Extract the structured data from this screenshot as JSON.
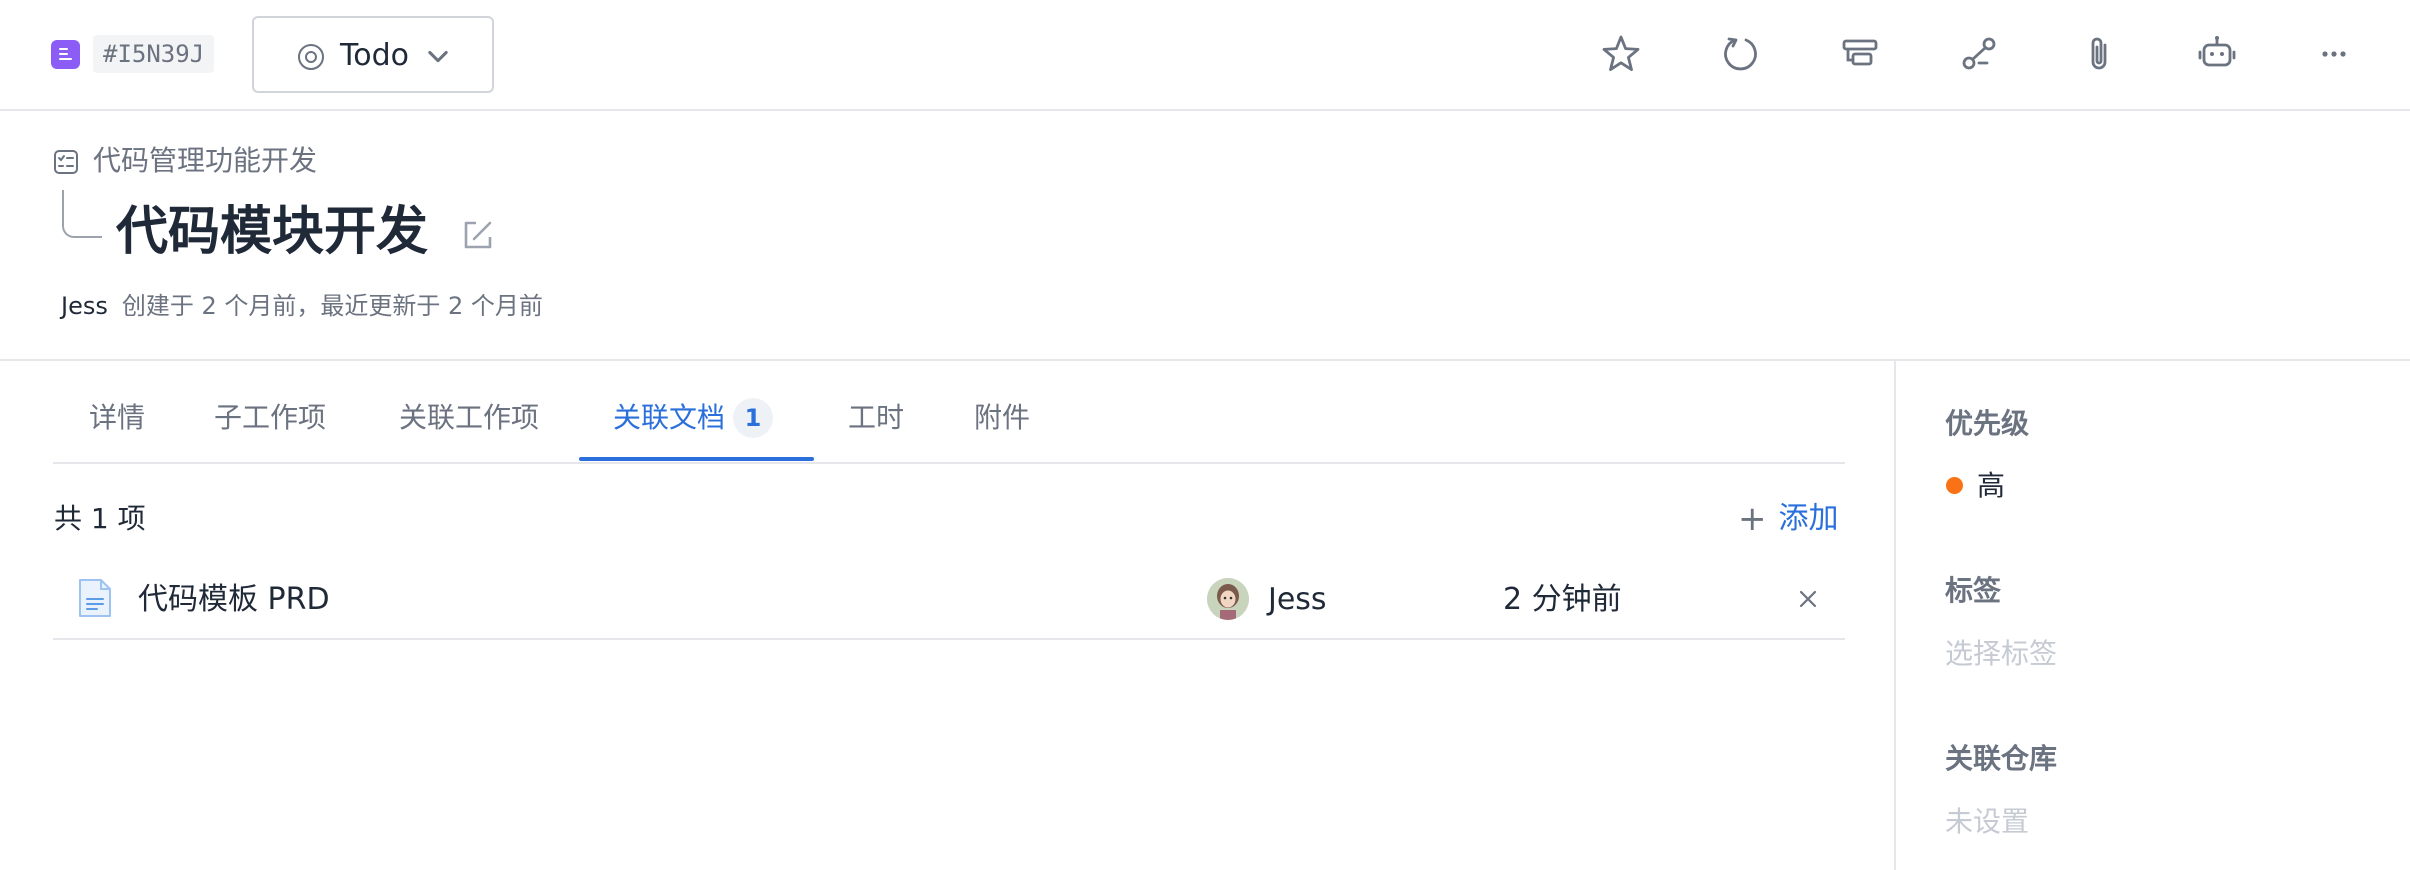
{
  "topbar": {
    "issue_id": "#I5N39J",
    "status_label": "Todo",
    "tools": [
      "star-icon",
      "refresh-icon",
      "layout-icon",
      "workflow-icon",
      "attachment-icon",
      "robot-icon",
      "more-icon"
    ]
  },
  "header": {
    "parent_title": "代码管理功能开发",
    "title": "代码模块开发",
    "author": "Jess",
    "meta_text": "创建于 2 个月前，最近更新于 2 个月前"
  },
  "tabs": [
    {
      "label": "详情"
    },
    {
      "label": "子工作项"
    },
    {
      "label": "关联工作项"
    },
    {
      "label": "关联文档",
      "count": "1",
      "active": true
    },
    {
      "label": "工时"
    },
    {
      "label": "附件"
    }
  ],
  "list": {
    "total_label": "共 1 项",
    "add_label": "添加",
    "items": [
      {
        "name": "代码模板 PRD",
        "author": "Jess",
        "time": "2 分钟前"
      }
    ]
  },
  "sidebar": {
    "priority_label": "优先级",
    "priority_value": "高",
    "tags_label": "标签",
    "tags_placeholder": "选择标签",
    "repo_label": "关联仓库",
    "repo_placeholder": "未设置"
  },
  "colors": {
    "accent": "#2a6fdb",
    "type_icon": "#8b5cf6",
    "priority_high": "#f97316"
  }
}
